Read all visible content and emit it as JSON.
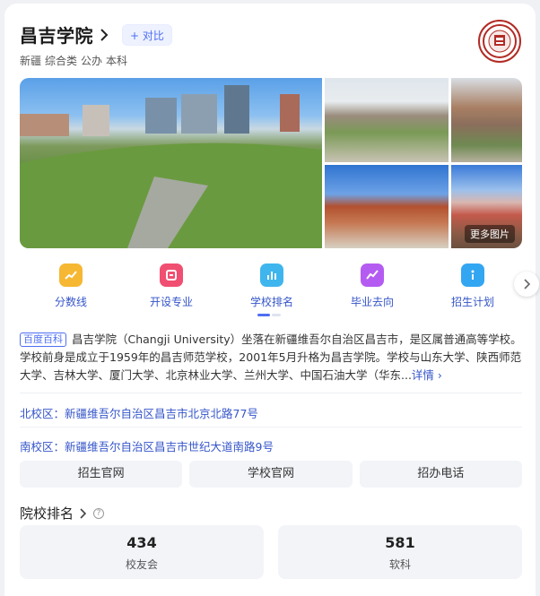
{
  "header": {
    "title": "昌吉学院",
    "compare_label": "+ 对比",
    "tags": [
      "新疆",
      "综合类",
      "公办",
      "本科"
    ]
  },
  "gallery": {
    "more_label": "更多图片"
  },
  "nav": {
    "items": [
      {
        "label": "分数线",
        "icon": "score-line-icon",
        "color": "#f6b733"
      },
      {
        "label": "开设专业",
        "icon": "major-icon",
        "color": "#f04f71"
      },
      {
        "label": "学校排名",
        "icon": "ranking-icon",
        "color": "#3fb5ee"
      },
      {
        "label": "毕业去向",
        "icon": "career-icon",
        "color": "#b45cf2"
      },
      {
        "label": "招生计划",
        "icon": "enroll-plan-icon",
        "color": "#33a6f2"
      }
    ]
  },
  "intro": {
    "source_tag": "百度百科",
    "text": "昌吉学院（Changji University）坐落在新疆维吾尔自治区昌吉市，是区属普通高等学校。学校前身是成立于1959年的昌吉师范学校，2001年5月升格为昌吉学院。学校与山东大学、陕西师范大学、吉林大学、厦门大学、北京林业大学、兰州大学、中国石油大学（华东...",
    "more_label": "详情 ›"
  },
  "campuses": [
    {
      "label": "北校区：新疆维吾尔自治区昌吉市北京北路77号"
    },
    {
      "label": "南校区：新疆维吾尔自治区昌吉市世纪大道南路9号"
    }
  ],
  "links": [
    "招生官网",
    "学校官网",
    "招办电话"
  ],
  "ranking": {
    "title": "院校排名",
    "items": [
      {
        "value": "434",
        "label": "校友会"
      },
      {
        "value": "581",
        "label": "软科"
      }
    ]
  }
}
